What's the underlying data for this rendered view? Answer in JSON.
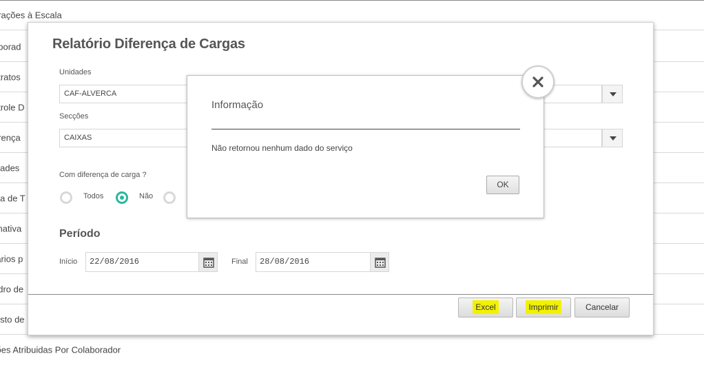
{
  "background_list": {
    "items": [
      "erações à Escala",
      "aborad",
      "ntratos",
      "ntrole D",
      "erença",
      "idades",
      "ala de T",
      "imativa",
      "rarios p",
      "adro de",
      "gisto de",
      "ções Atribuidas Por Colaborador"
    ]
  },
  "report_modal": {
    "title": "Relatório Diferença de Cargas",
    "unidades_label": "Unidades",
    "unidades_value": "CAF-ALVERCA",
    "seccoes_label": "Secções",
    "seccoes_value": "CAIXAS",
    "carga_label": "Com diferença de carga ?",
    "radio_todos": "Todos",
    "radio_nao": "Não",
    "periodo_title": "Período",
    "inicio_label": "Início",
    "inicio_value": "22/08/2016",
    "final_label": "Final",
    "final_value": "28/08/2016",
    "excel_label": "Excel",
    "imprimir_label": "Imprimir",
    "cancelar_label": "Cancelar"
  },
  "info_dialog": {
    "title": "Informação",
    "message": "Não retornou nenhum dado do serviço",
    "ok_label": "OK"
  },
  "colors": {
    "accent": "#29b7a0",
    "highlight": "#f2f200"
  },
  "icons": [
    "calendar-icon",
    "close-icon",
    "chevron-down-icon"
  ]
}
